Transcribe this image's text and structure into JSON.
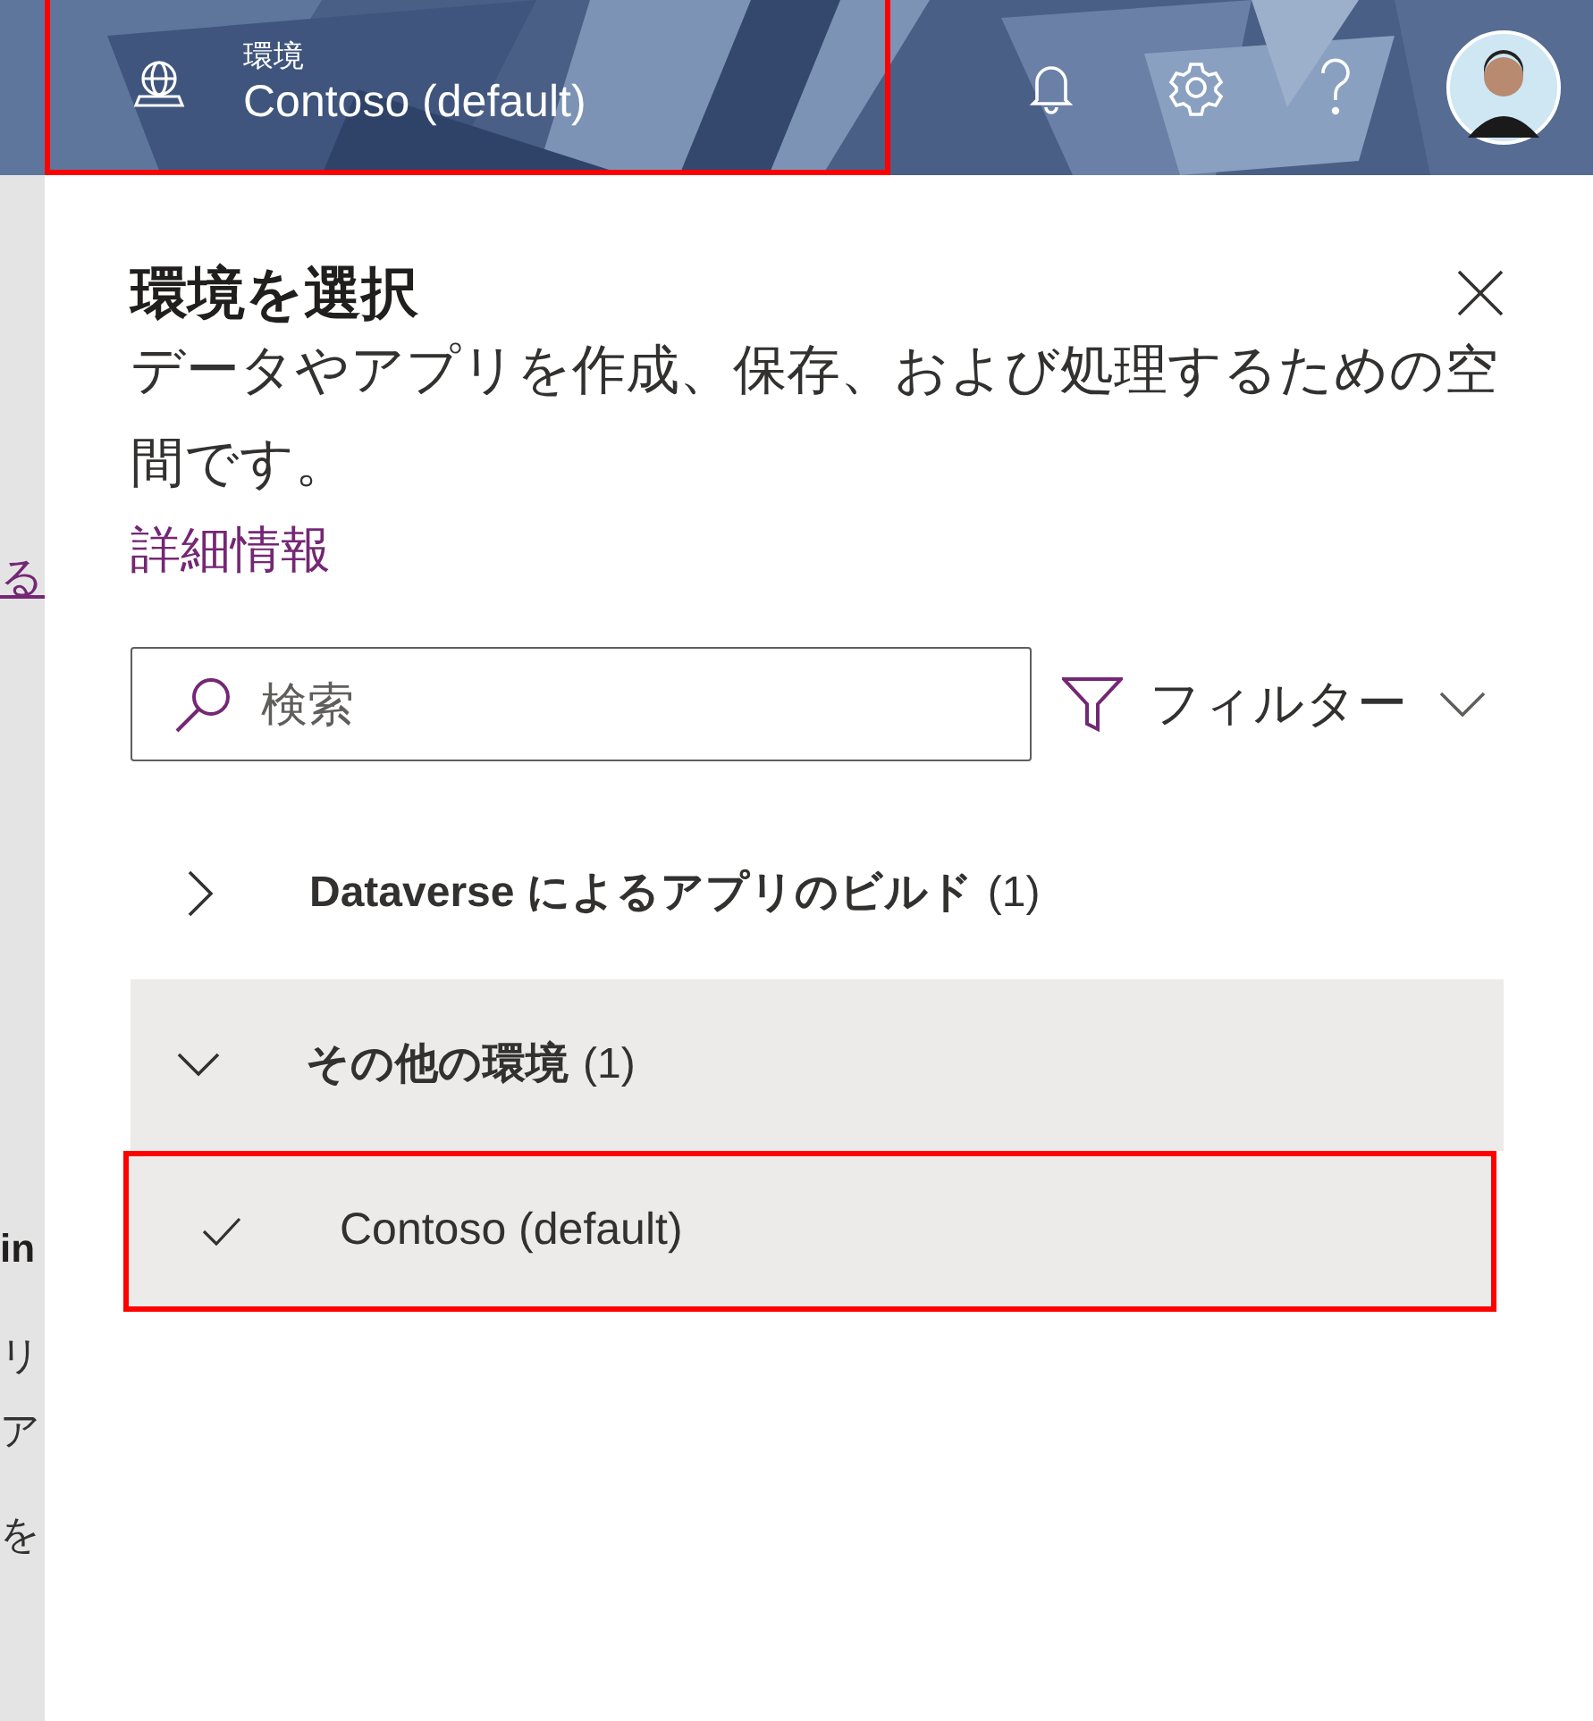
{
  "header": {
    "environment_label": "環境",
    "environment_name": "Contoso (default)",
    "highlighted": true
  },
  "background_texts": [
    {
      "kind": "link",
      "text": "る"
    },
    {
      "kind": "heading",
      "text": "in"
    },
    {
      "kind": "body",
      "text": "リ"
    },
    {
      "kind": "body",
      "text": "ア"
    },
    {
      "kind": "body",
      "text": "を"
    }
  ],
  "panel": {
    "title": "環境を選択",
    "description": "データやアプリを作成、保存、および処理するための空間です。",
    "link": "詳細情報",
    "search": {
      "placeholder": "検索"
    },
    "filter": "フィルター",
    "groups": [
      {
        "label": "Dataverse によるアプリのビルド",
        "count": "(1)",
        "expanded": false
      },
      {
        "label": "その他の環境",
        "count": "(1)",
        "expanded": true,
        "items": [
          {
            "label": "Contoso (default)",
            "selected": true,
            "highlighted": true
          }
        ]
      }
    ]
  }
}
